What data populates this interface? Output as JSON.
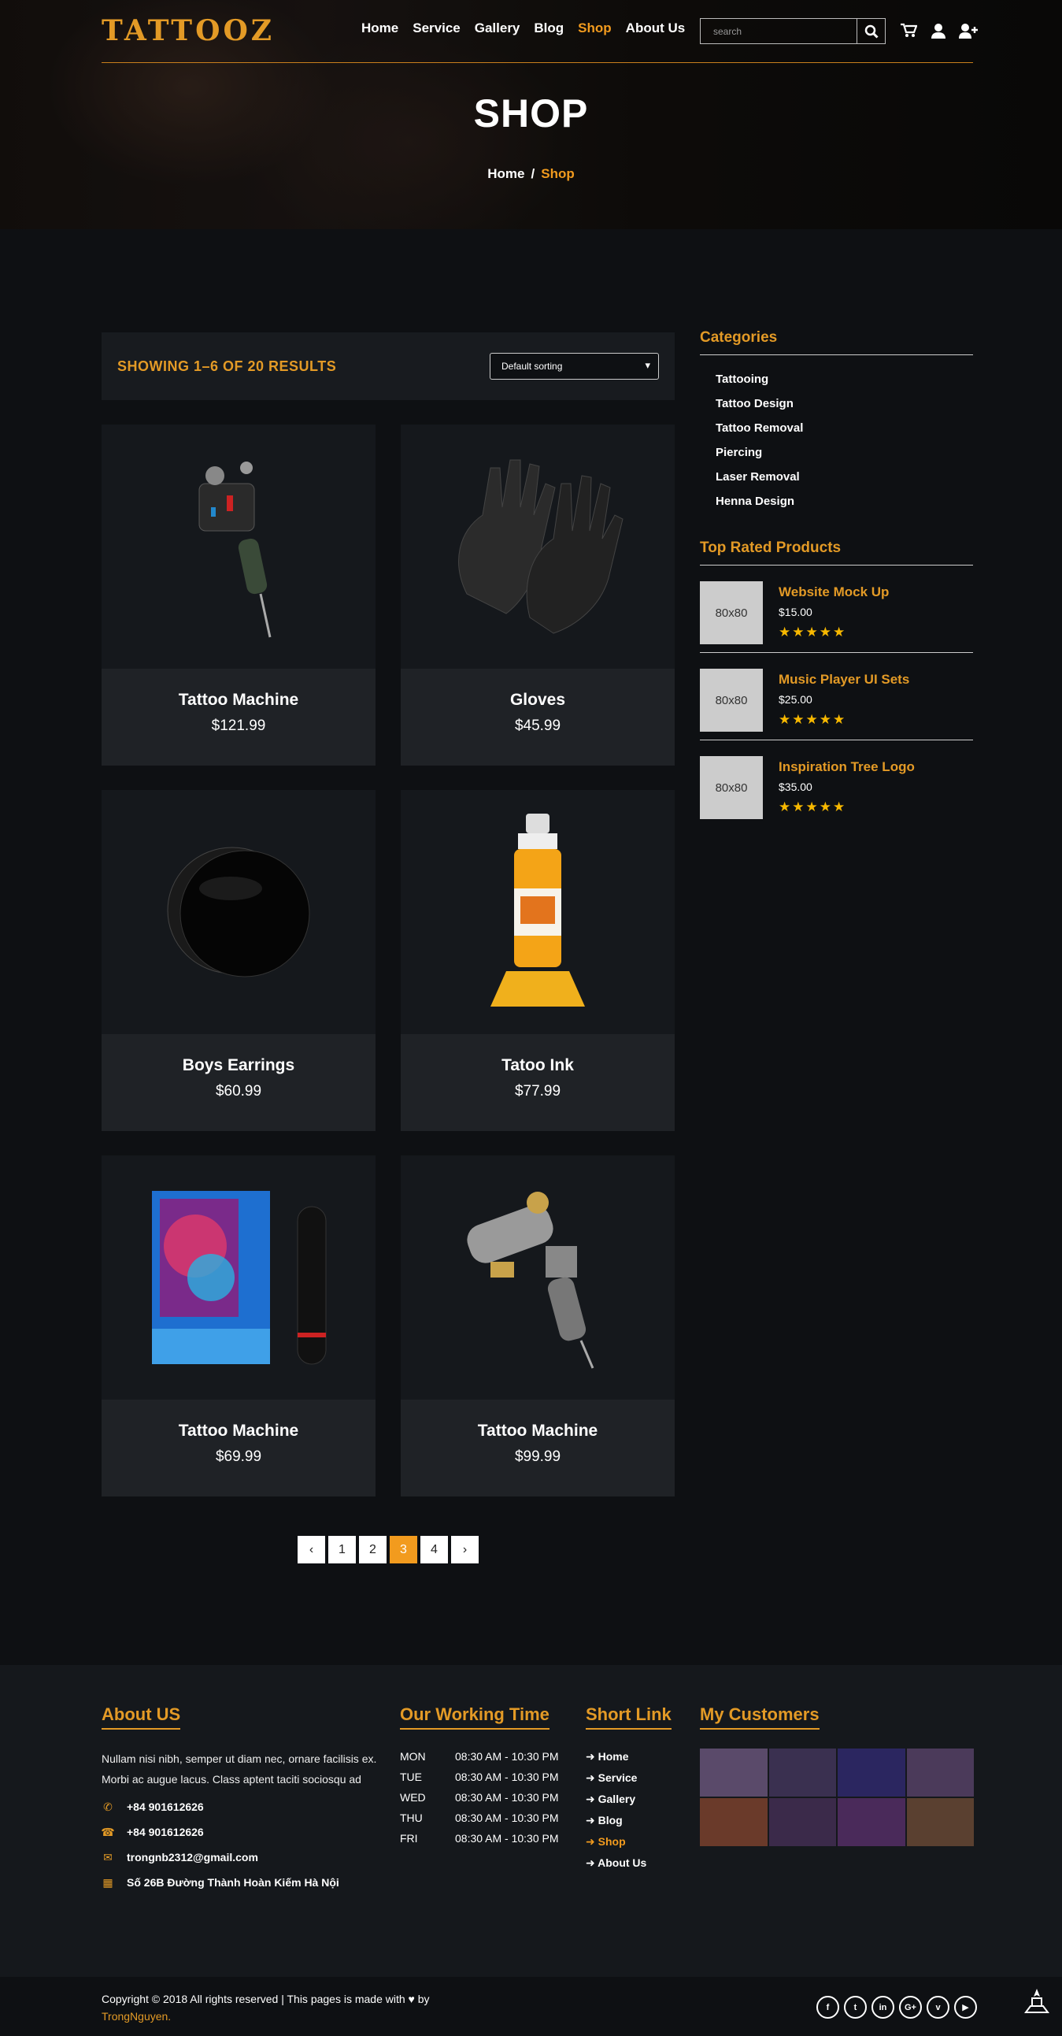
{
  "header": {
    "logo": "TATTOOZ",
    "menu": [
      {
        "label": "Home",
        "active": false
      },
      {
        "label": "Service",
        "active": false
      },
      {
        "label": "Gallery",
        "active": false
      },
      {
        "label": "Blog",
        "active": false
      },
      {
        "label": "Shop",
        "active": true
      },
      {
        "label": "About Us",
        "active": false
      }
    ],
    "search_placeholder": "search",
    "icons": [
      "search-icon",
      "cart-icon",
      "user-icon",
      "user-plus-icon"
    ]
  },
  "hero": {
    "title": "SHOP",
    "breadcrumb_home": "Home",
    "breadcrumb_sep": "/",
    "breadcrumb_current": "Shop"
  },
  "shop": {
    "results_text": "SHOWING 1–6 OF 20 RESULTS",
    "sort_value": "Default sorting",
    "products": [
      {
        "name": "Tattoo Machine",
        "price": "$121.99",
        "icon": "tattoo-machine-image"
      },
      {
        "name": "Gloves",
        "price": "$45.99",
        "icon": "gloves-image"
      },
      {
        "name": "Boys Earrings",
        "price": "$60.99",
        "icon": "earring-image"
      },
      {
        "name": "Tatoo Ink",
        "price": "$77.99",
        "icon": "ink-bottle-image"
      },
      {
        "name": "Tattoo Machine",
        "price": "$69.99",
        "icon": "tattoo-pen-image"
      },
      {
        "name": "Tattoo Machine",
        "price": "$99.99",
        "icon": "rotary-machine-image"
      }
    ],
    "pagination": {
      "prev": "‹",
      "pages": [
        "1",
        "2",
        "3",
        "4"
      ],
      "current": "3",
      "next": "›"
    }
  },
  "sidebar": {
    "categories_title": "Categories",
    "categories": [
      "Tattooing",
      "Tattoo Design",
      "Tattoo Removal",
      "Piercing",
      "Laser Removal",
      "Henna Design"
    ],
    "top_rated_title": "Top Rated Products",
    "top_rated": [
      {
        "thumb": "80x80",
        "title": "Website Mock Up",
        "price": "$15.00",
        "stars": "★★★★★"
      },
      {
        "thumb": "80x80",
        "title": "Music Player UI Sets",
        "price": "$25.00",
        "stars": "★★★★★"
      },
      {
        "thumb": "80x80",
        "title": "Inspiration Tree Logo",
        "price": "$35.00",
        "stars": "★★★★★"
      }
    ]
  },
  "footer": {
    "about_title": "About US",
    "about_text": "Nullam nisi nibh, semper ut diam nec, ornare facilisis ex. Morbi ac augue lacus. Class aptent taciti sociosqu ad",
    "contacts": [
      {
        "icon": "phone-icon",
        "text": "+84 901612626"
      },
      {
        "icon": "fax-icon",
        "text": "+84 901612626"
      },
      {
        "icon": "envelope-icon",
        "text": "trongnb2312@gmail.com"
      },
      {
        "icon": "map-icon",
        "text": "Số 26B Đường Thành Hoàn Kiếm Hà Nội"
      }
    ],
    "hours_title": "Our Working Time",
    "hours": [
      {
        "day": "MON",
        "time": "08:30 AM - 10:30 PM"
      },
      {
        "day": "TUE",
        "time": "08:30 AM - 10:30 PM"
      },
      {
        "day": "WED",
        "time": "08:30 AM - 10:30 PM"
      },
      {
        "day": "THU",
        "time": "08:30 AM - 10:30 PM"
      },
      {
        "day": "FRI",
        "time": "08:30 AM - 10:30 PM"
      }
    ],
    "links_title": "Short Link",
    "links": [
      {
        "label": "Home",
        "active": false
      },
      {
        "label": "Service",
        "active": false
      },
      {
        "label": "Gallery",
        "active": false
      },
      {
        "label": "Blog",
        "active": false
      },
      {
        "label": "Shop",
        "active": true
      },
      {
        "label": "About Us",
        "active": false
      }
    ],
    "customers_title": "My Customers"
  },
  "bottom": {
    "copyright": "Copyright © 2018 All rights reserved | This pages is made with",
    "by": "by",
    "author": "TrongNguyen.",
    "social": [
      "f",
      "t",
      "in",
      "G+",
      "v",
      "▶"
    ]
  },
  "colors": {
    "accent": "#f29b1e",
    "bg": "#0e1013",
    "card": "#15181c"
  }
}
